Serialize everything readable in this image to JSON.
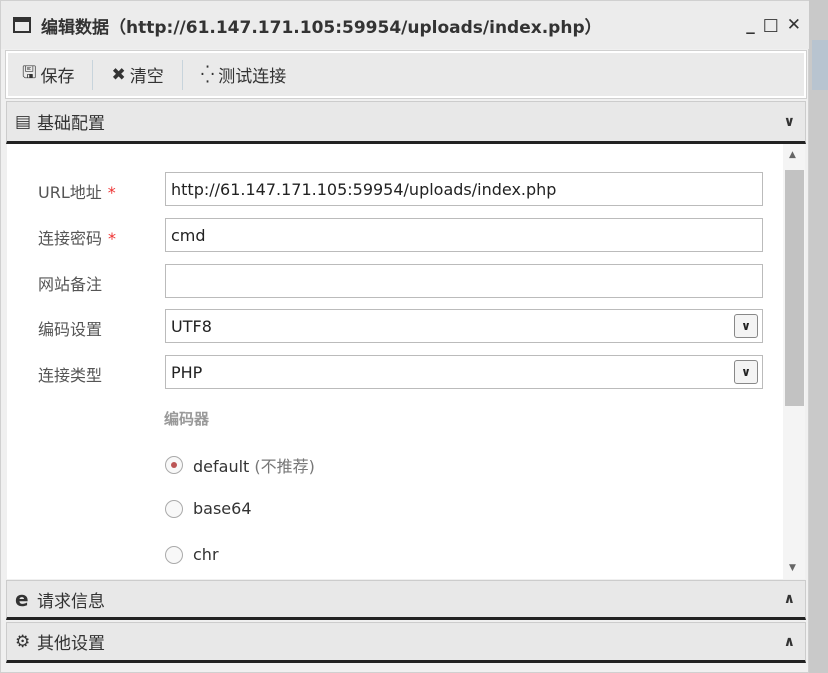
{
  "window": {
    "title": "编辑数据（http://61.147.171.105:59954/uploads/index.php）",
    "min": "_",
    "max": "□",
    "close": "✕"
  },
  "toolbar": {
    "save": "保存",
    "clear": "清空",
    "test": "测试连接"
  },
  "sections": {
    "basic": "基础配置",
    "request": "请求信息",
    "other": "其他设置"
  },
  "form": {
    "url_label": "URL地址",
    "url_value": "http://61.147.171.105:59954/uploads/index.php",
    "password_label": "连接密码",
    "password_value": "cmd",
    "note_label": "网站备注",
    "note_value": "",
    "encoding_label": "编码设置",
    "encoding_value": "UTF8",
    "type_label": "连接类型",
    "type_value": "PHP",
    "required_mark": "*",
    "encoder_label": "编码器",
    "encoders": [
      {
        "label": "default",
        "note": "(不推荐)",
        "selected": true
      },
      {
        "label": "base64",
        "selected": false
      },
      {
        "label": "chr",
        "selected": false
      }
    ]
  }
}
